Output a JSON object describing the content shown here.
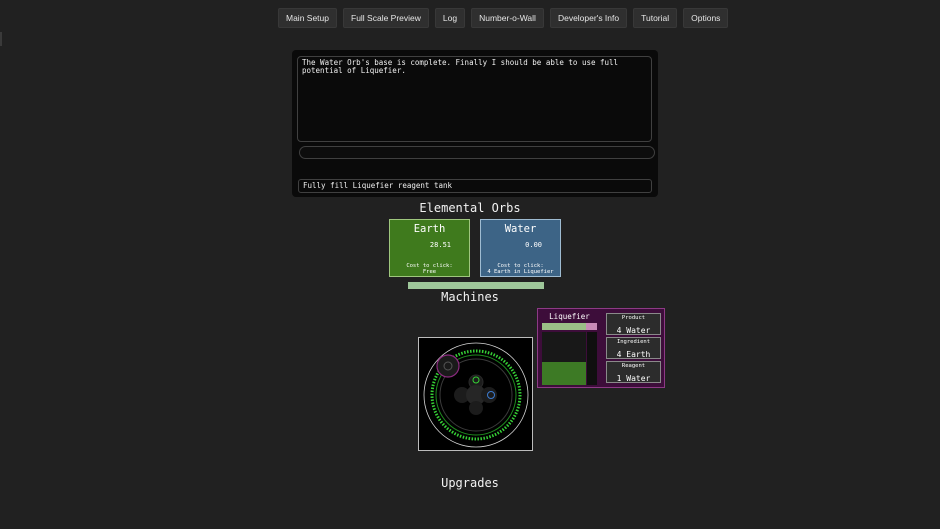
{
  "nav": [
    "Main Setup",
    "Full Scale Preview",
    "Log",
    "Number-o-Wall",
    "Developer's Info",
    "Tutorial",
    "Options"
  ],
  "story": {
    "log_text": "The Water Orb's base is complete. Finally I should be able to use full potential of Liquefier.",
    "objective": "Fully fill Liquefier reagent tank"
  },
  "sections": {
    "orbs": "Elemental Orbs",
    "machines": "Machines",
    "upgrades": "Upgrades"
  },
  "orbs": [
    {
      "name": "Earth",
      "amount": "28.51",
      "cost_label": "Cost to click:",
      "cost": "Free",
      "color": "#3f7a1d"
    },
    {
      "name": "Water",
      "amount": "0.00",
      "cost_label": "Cost to click:",
      "cost": "4 Earth in Liquefier",
      "color": "#3d6486"
    }
  ],
  "orb_progress": 1.0,
  "liquefier": {
    "title": "Liquefier",
    "progress": 0.8,
    "tank_level": 0.43,
    "slots": [
      {
        "label": "Product",
        "value": "4 Water"
      },
      {
        "label": "Ingredient",
        "value": "4 Earth"
      },
      {
        "label": "Reagent",
        "value": "1 Water"
      }
    ],
    "colors": {
      "panel": "#3d0d3a",
      "fill": "#3d7a25"
    }
  },
  "icons": {
    "diagram": "machine-diagram-icon"
  }
}
